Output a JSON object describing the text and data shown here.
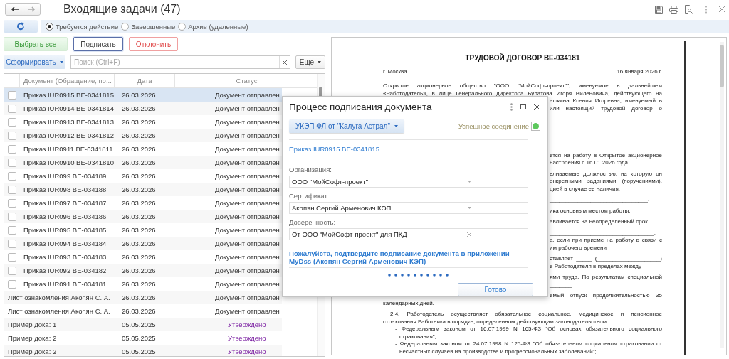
{
  "title": "Входящие задачи (47)",
  "filter": {
    "options": [
      {
        "label": "Требуется действие",
        "selected": true
      },
      {
        "label": "Завершенные",
        "selected": false
      },
      {
        "label": "Архив (удаленные)",
        "selected": false
      }
    ]
  },
  "actions": [
    {
      "label": "Выбрать все",
      "kind": "accept",
      "selected": false
    },
    {
      "label": "Подписать",
      "kind": "neutral",
      "selected": true
    },
    {
      "label": "Отклонить",
      "kind": "reject",
      "selected": false
    }
  ],
  "form_button": "Сформировать",
  "search": {
    "placeholder": "Поиск (Ctrl+F)"
  },
  "more_button": "Еще",
  "table": {
    "columns": [
      "Документ (Обращение, пр...",
      "Дата",
      "Статус"
    ],
    "rows": [
      {
        "kind": "checkbox",
        "checked": false,
        "selected": true,
        "document": "Приказ IUR0915 BE-0341815",
        "date": "26.03.2026",
        "status": "Документ отправлен",
        "approved": false
      },
      {
        "kind": "checkbox",
        "checked": false,
        "selected": false,
        "document": "Приказ IUR0914 BE-0341814",
        "date": "26.03.2026",
        "status": "Документ отправлен",
        "approved": false
      },
      {
        "kind": "checkbox",
        "checked": false,
        "selected": false,
        "document": "Приказ IUR0913 BE-0341813",
        "date": "26.03.2026",
        "status": "Документ отправлен",
        "approved": false
      },
      {
        "kind": "checkbox",
        "checked": false,
        "selected": false,
        "document": "Приказ IUR0912 BE-0341812",
        "date": "26.03.2026",
        "status": "Документ отправлен",
        "approved": false
      },
      {
        "kind": "checkbox",
        "checked": false,
        "selected": false,
        "document": "Приказ IUR0911 BE-0341811",
        "date": "26.03.2026",
        "status": "Документ отправлен",
        "approved": false
      },
      {
        "kind": "checkbox",
        "checked": false,
        "selected": false,
        "document": "Приказ IUR0910 BE-0341810",
        "date": "26.03.2026",
        "status": "Документ отправлен",
        "approved": false
      },
      {
        "kind": "checkbox",
        "checked": false,
        "selected": false,
        "document": "Приказ IUR099 BE-034189",
        "date": "26.03.2026",
        "status": "Документ отправлен",
        "approved": false
      },
      {
        "kind": "checkbox",
        "checked": false,
        "selected": false,
        "document": "Приказ IUR098 BE-034188",
        "date": "26.03.2026",
        "status": "Документ отправлен",
        "approved": false
      },
      {
        "kind": "checkbox",
        "checked": false,
        "selected": false,
        "document": "Приказ IUR097 BE-034187",
        "date": "26.03.2026",
        "status": "Документ отправлен",
        "approved": false
      },
      {
        "kind": "checkbox",
        "checked": false,
        "selected": false,
        "document": "Приказ IUR096 BE-034186",
        "date": "26.03.2026",
        "status": "Документ отправлен",
        "approved": false
      },
      {
        "kind": "checkbox",
        "checked": false,
        "selected": false,
        "document": "Приказ IUR095 BE-034185",
        "date": "26.03.2026",
        "status": "Документ отправлен",
        "approved": false
      },
      {
        "kind": "checkbox",
        "checked": false,
        "selected": false,
        "document": "Приказ IUR094 BE-034184",
        "date": "26.03.2026",
        "status": "Документ отправлен",
        "approved": false
      },
      {
        "kind": "checkbox",
        "checked": false,
        "selected": false,
        "document": "Приказ IUR093 BE-034183",
        "date": "26.03.2026",
        "status": "Документ отправлен",
        "approved": false
      },
      {
        "kind": "checkbox",
        "checked": false,
        "selected": false,
        "document": "Приказ IUR092 BE-034182",
        "date": "26.03.2026",
        "status": "Документ отправлен",
        "approved": false
      },
      {
        "kind": "checkbox",
        "checked": false,
        "selected": false,
        "document": "Приказ IUR091 BE-034181",
        "date": "26.03.2026",
        "status": "Документ отправлен",
        "approved": false
      },
      {
        "kind": "plain",
        "selected": false,
        "document": "Лист ознакомления Акопян С. А.",
        "date": "26.03.2026",
        "status": "Документ отправлен",
        "approved": false
      },
      {
        "kind": "plain",
        "selected": false,
        "document": "Лист ознакомления Акопян С. А.",
        "date": "26.03.2026",
        "status": "Документ отправлен",
        "approved": false
      },
      {
        "kind": "plain",
        "selected": false,
        "document": "Пример дока: 1",
        "date": "05.05.2025",
        "status": "Утверждено",
        "approved": true
      },
      {
        "kind": "plain",
        "selected": false,
        "document": "Пример дока: 2",
        "date": "05.05.2025",
        "status": "Утверждено",
        "approved": true
      },
      {
        "kind": "plain",
        "selected": false,
        "document": "Пример дока: 2",
        "date": "05.05.2025",
        "status": "Утверждено",
        "approved": true
      }
    ]
  },
  "document": {
    "title": "ТРУДОВОЙ ДОГОВОР BE-034181",
    "city": "г. Москва",
    "date": "16 января 2026 г.",
    "paragraphs": [
      {
        "lines": [
          {
            "text": "Открытое акционерное общество \"ООО \"МойСофт-проект\"\", именуемое в дальнейшем",
            "kind": "plain",
            "justify": true,
            "cut": false
          },
          {
            "text": "«Работодатель», в лице Генерального директора Булатова Игоря Виленовича, действующего на",
            "kind": "plain",
            "justify": true,
            "cut": false
          },
          {
            "text": "ашкина Ксения Игоревна, именуемый в",
            "kind": "plain",
            "justify": true,
            "cut": true
          },
          {
            "text": "или настоящий трудовой договор о",
            "kind": "plain",
            "justify": true,
            "cut": true
          }
        ]
      },
      {
        "lines": [
          {
            "text": "ется на работу в Открытое акционерное",
            "kind": "plain",
            "justify": true,
            "cut": true
          },
          {
            "text": "настроения с 16.01.2026 года.",
            "kind": "plain",
            "justify": false,
            "cut": true
          }
        ]
      },
      {
        "lines": [
          {
            "text": "вливаемые должностью, на которую он",
            "kind": "plain",
            "justify": true,
            "cut": true
          },
          {
            "text": "онкретными заданиями (поручениями),",
            "kind": "plain",
            "justify": true,
            "cut": true
          },
          {
            "text": "цией в случае ее наличия.",
            "kind": "plain",
            "justify": false,
            "cut": true
          }
        ]
      },
      {
        "lines": [
          {
            "text": "_______________________________.",
            "kind": "plain",
            "cut": true
          }
        ]
      },
      {
        "lines": [
          {
            "text": "ика основным местом работы.",
            "kind": "plain",
            "justify": false,
            "cut": true
          }
        ]
      },
      {
        "lines": [
          {
            "text": "авливается на неопределенный срок.",
            "kind": "plain",
            "justify": false,
            "cut": true
          }
        ]
      },
      {
        "lines": [
          {
            "text": "_________________________________.",
            "kind": "plain",
            "cut": true
          },
          {
            "text": "а, если при приеме на работу в связи с",
            "kind": "plain",
            "justify": true,
            "cut": true
          },
          {
            "text": "им рабочего времени",
            "kind": "plain",
            "justify": false,
            "cut": true
          }
        ]
      },
      {
        "lines": [
          {
            "text": "ставляет _____ (____________________)",
            "kind": "plain",
            "justify": true,
            "cut": true
          },
          {
            "text": "е Работодателя в пределах между ______",
            "kind": "plain",
            "justify": true,
            "cut": true
          }
        ]
      },
      {
        "lines": [
          {
            "text": "ями труда. По результатам специальной",
            "kind": "plain",
            "justify": true,
            "cut": true
          },
          {
            "text": "_______.",
            "kind": "plain",
            "cut": true
          }
        ]
      },
      {
        "lines": [
          {
            "text": "емый отпуск продолжительностью 35",
            "kind": "plain",
            "justify": true,
            "cut": true
          },
          {
            "text": "календарных дней.",
            "kind": "plain",
            "justify": false,
            "cut": false
          }
        ]
      },
      {
        "lines": [
          {
            "text": "2.4. Работодатель осуществляет обязательное социальное, медицинское и пенсионное",
            "kind": "indent",
            "justify": true,
            "cut": false
          },
          {
            "text": "страхования Работника в порядке, определенном действующим законодательством:",
            "kind": "plain",
            "justify": false,
            "cut": false
          },
          {
            "text": "- Федеральным законом от 16.07.1999 N 165-ФЗ \"Об основах обязательного социального",
            "kind": "item",
            "justify": true,
            "cut": false
          },
          {
            "text": "страхования\";",
            "kind": "item_cont",
            "cut": false
          },
          {
            "text": "- Федеральным законом от 24.07.1998 N 125-ФЗ \"Об обязательном социальном страховании от",
            "kind": "item",
            "justify": true,
            "cut": false
          },
          {
            "text": "несчастных случаев на производстве и профессиональных заболеваний\";",
            "kind": "item_cont",
            "justify": false,
            "cut": false
          }
        ]
      }
    ]
  },
  "dialog": {
    "title": "Процесс подписания документа",
    "certificate_button": "УКЭП ФЛ от \"Калуга Астрал\"",
    "connection": {
      "label": "Успешное соединение",
      "connected": true
    },
    "document_link": "Приказ IUR0915 BE-0341815",
    "fields": [
      {
        "label": "Организация:",
        "value": "ООО \"МойСофт-проект\"",
        "kind": "select"
      },
      {
        "label": "Сертификат:",
        "value": "Акопян Сергий Арменович КЭП",
        "kind": "select"
      },
      {
        "label": "Доверенность:",
        "value": "От ООО \"МойСофт-проект\" для ПКД",
        "kind": "clearable"
      }
    ],
    "message": "Пожалуйста, подтвердите подписание документа в приложении MyDss (Акопян Сергий Арменович КЭП)",
    "done_button": "Готово"
  }
}
